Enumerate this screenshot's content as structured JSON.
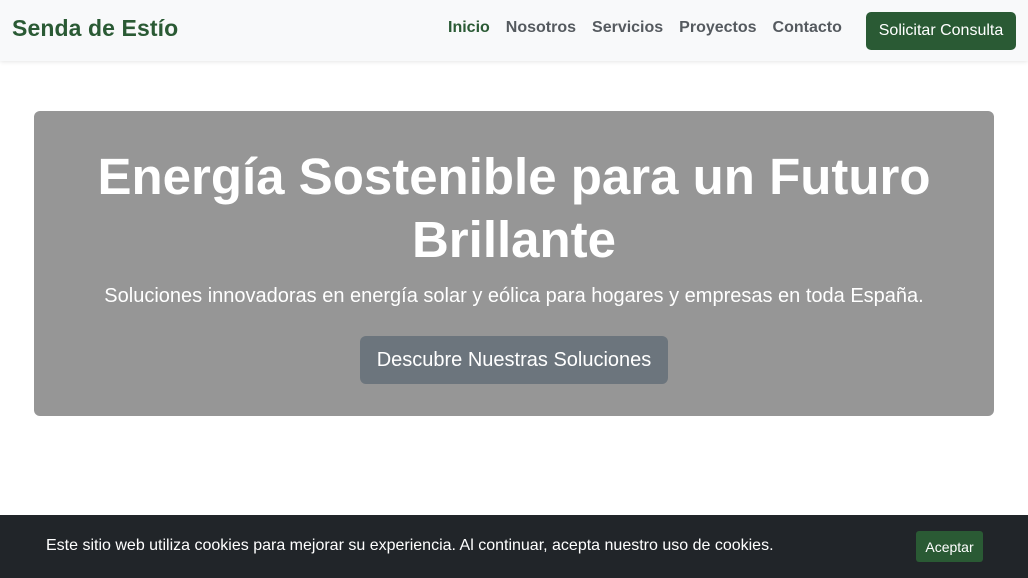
{
  "navbar": {
    "brand": "Senda de Estío",
    "links": [
      {
        "label": "Inicio",
        "active": true
      },
      {
        "label": "Nosotros",
        "active": false
      },
      {
        "label": "Servicios",
        "active": false
      },
      {
        "label": "Proyectos",
        "active": false
      },
      {
        "label": "Contacto",
        "active": false
      }
    ],
    "cta_label": "Solicitar Consulta"
  },
  "hero": {
    "title": "Energía Sostenible para un Futuro Brillante",
    "subtitle": "Soluciones innovadoras en energía solar y eólica para hogares y empresas en toda España.",
    "button_label": "Descubre Nuestras Soluciones"
  },
  "cookie_banner": {
    "text": "Este sitio web utiliza cookies para mejorar su experiencia. Al continuar, acepta nuestro uso de cookies.",
    "accept_label": "Aceptar"
  },
  "colors": {
    "brand_green": "#2a5a34",
    "navbar_bg": "#f8f9fa",
    "hero_bg": "#969696",
    "secondary_button": "#6c757d",
    "cookie_bg": "#212529"
  }
}
